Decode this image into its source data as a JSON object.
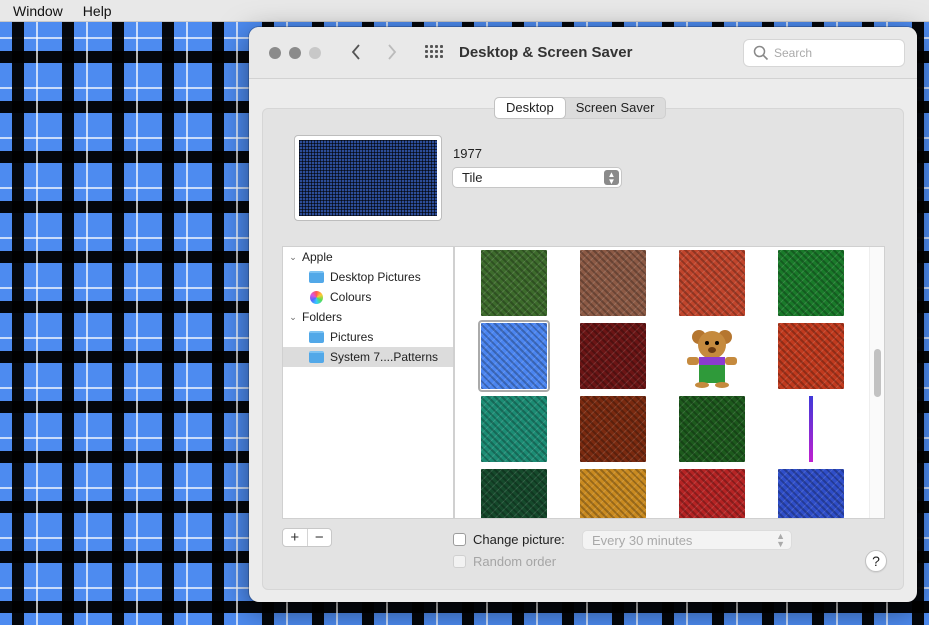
{
  "menubar": {
    "items": [
      "Window",
      "Help"
    ]
  },
  "window": {
    "title": "Desktop & Screen Saver",
    "search_placeholder": "Search",
    "nav": {
      "back_icon": "chevron-left-icon",
      "forward_icon": "chevron-right-icon",
      "grid_icon": "grid-icon"
    }
  },
  "tabs": [
    {
      "label": "Desktop",
      "active": true
    },
    {
      "label": "Screen Saver",
      "active": false
    }
  ],
  "current_picture": {
    "name": "1977",
    "fit_option": "Tile"
  },
  "sources": [
    {
      "label": "Apple",
      "type": "group"
    },
    {
      "label": "Desktop Pictures",
      "type": "folder"
    },
    {
      "label": "Colours",
      "type": "colours"
    },
    {
      "label": "Folders",
      "type": "group"
    },
    {
      "label": "Pictures",
      "type": "folder"
    },
    {
      "label": "System 7....Patterns",
      "type": "folder",
      "selected": true
    }
  ],
  "thumbnail_colors": [
    [
      "#3d6b2c",
      "#8c5a45",
      "#c0452c",
      "#1a7a2a"
    ],
    [
      "#4b85f0",
      "#6b1515",
      "#f0f0f0",
      "#c03a1e"
    ],
    [
      "#1c8c74",
      "#7a2a10",
      "#1d5a1d",
      "#8a2bc8"
    ],
    [
      "#164a2c",
      "#c98a20",
      "#b52424",
      "#2f4ec8"
    ]
  ],
  "controls": {
    "add_label": "+",
    "remove_label": "−",
    "change_picture_label": "Change picture:",
    "interval_value": "Every 30 minutes",
    "random_order_label": "Random order",
    "help_label": "?"
  }
}
